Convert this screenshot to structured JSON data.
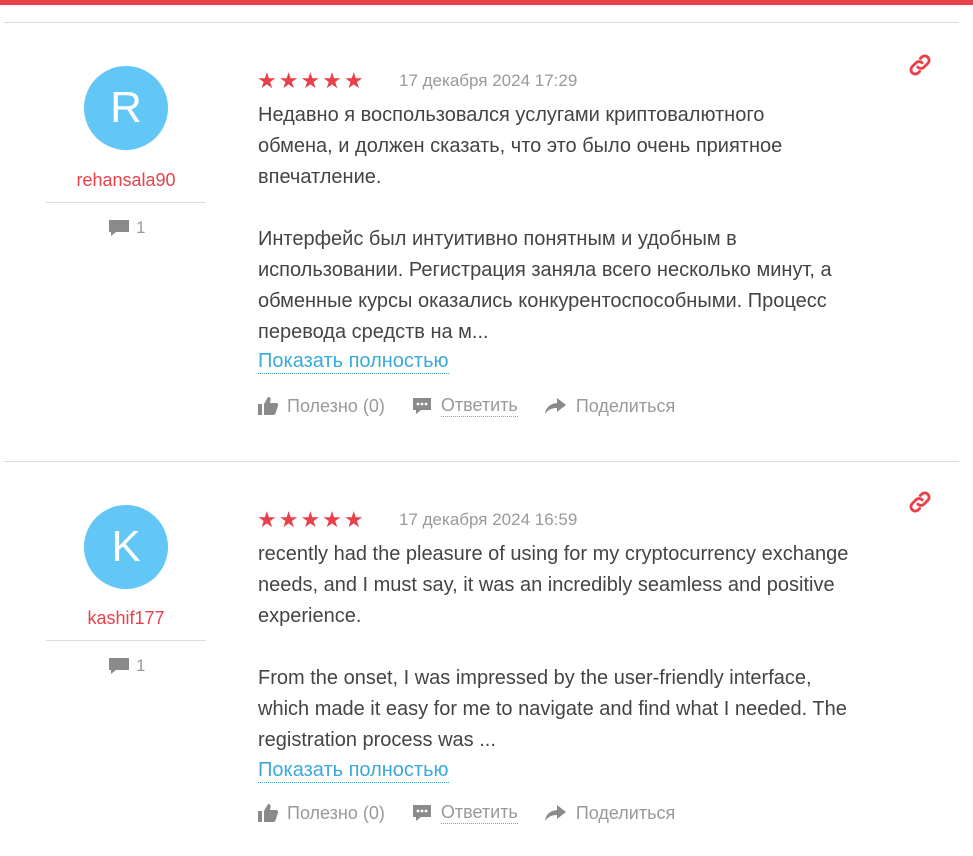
{
  "colors": {
    "accent": "#e8414a",
    "avatar": "#62c6f7",
    "link": "#3aa9dc"
  },
  "reviews": [
    {
      "avatar_letter": "R",
      "username": "rehansala90",
      "comment_count": "1",
      "stars": "★★★★★",
      "rating": 5,
      "date": "17 декабря 2024 17:29",
      "paragraph1": "Недавно я воспользовался услугами криптовалютного\nобмена, и должен сказать, что это было очень приятное\nвпечатление.",
      "paragraph2": "Интерфейс был интуитивно понятным и удобным в\nиспользовании. Регистрация заняла всего несколько минут, а\nобменные курсы оказались конкурентоспособными. Процесс\nперевода средств на м...",
      "show_more": "Показать полностью",
      "helpful": "Полезно (0)",
      "reply": "Ответить",
      "share": "Поделиться"
    },
    {
      "avatar_letter": "K",
      "username": "kashif177",
      "comment_count": "1",
      "stars": "★★★★★",
      "rating": 5,
      "date": "17 декабря 2024 16:59",
      "paragraph1": "recently had the pleasure of using for my cryptocurrency exchange\nneeds, and I must say, it was an incredibly seamless and positive\nexperience.",
      "paragraph2": "From the onset, I was impressed by the user-friendly interface,\nwhich made it easy for me to navigate and find what I needed. The\nregistration process was ...",
      "show_more": "Показать полностью",
      "helpful": "Полезно (0)",
      "reply": "Ответить",
      "share": "Поделиться"
    }
  ]
}
